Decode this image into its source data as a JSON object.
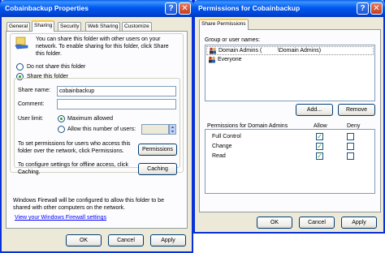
{
  "left_window": {
    "title": "Cobainbackup Properties",
    "help_label": "?",
    "close_label": "✕",
    "tabs": [
      "General",
      "Sharing",
      "Security",
      "Web Sharing",
      "Customize"
    ],
    "intro_text": "You can share this folder with other users on your network. To enable sharing for this folder, click Share this folder.",
    "do_not_share_label": "Do not share this folder",
    "share_label": "Share this folder",
    "share_name_label": "Share name:",
    "share_name_value": "cobainbackup",
    "comment_label": "Comment:",
    "comment_value": "",
    "user_limit_label": "User limit:",
    "max_allowed_label": "Maximum allowed",
    "allow_number_label": "Allow this number of users:",
    "user_count_value": "",
    "permissions_text": "To set permissions for users who access this folder over the network, click Permissions.",
    "permissions_button": "Permissions",
    "caching_text": "To configure settings for offline access, click Caching.",
    "caching_button": "Caching",
    "firewall_text": "Windows Firewall will be configured to allow this folder to be shared with other computers on the network.",
    "firewall_link": "View your Windows Firewall settings",
    "ok_button": "OK",
    "cancel_button": "Cancel",
    "apply_button": "Apply"
  },
  "right_window": {
    "title": "Permissions for Cobainbackup",
    "help_label": "?",
    "close_label": "✕",
    "tab": "Share Permissions",
    "group_label": "Group or user names:",
    "users": [
      "Domain Admins (          \\Domain Admins)",
      "Everyone"
    ],
    "add_button": "Add...",
    "remove_button": "Remove",
    "permissions_header": "Permissions for Domain Admins",
    "allow_header": "Allow",
    "deny_header": "Deny",
    "permissions": [
      {
        "name": "Full Control",
        "allow": true,
        "deny": false
      },
      {
        "name": "Change",
        "allow": true,
        "deny": false
      },
      {
        "name": "Read",
        "allow": true,
        "deny": false
      }
    ],
    "ok_button": "OK",
    "cancel_button": "Cancel",
    "apply_button": "Apply"
  }
}
